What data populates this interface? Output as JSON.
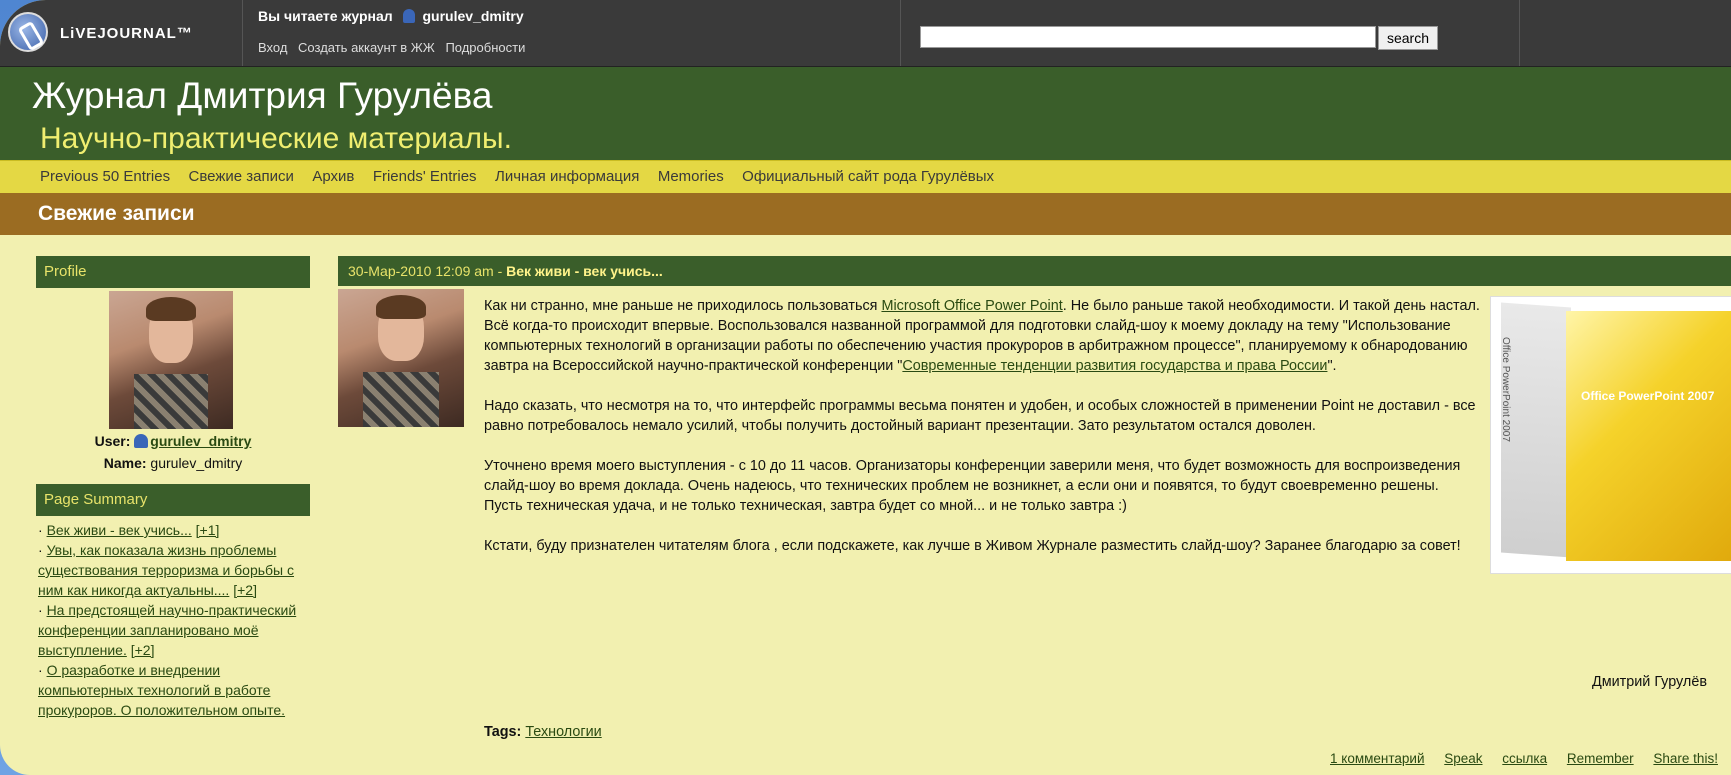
{
  "top": {
    "logo": "LiVEJOURNAL™",
    "reading_prefix": "Вы читаете журнал",
    "reading_user": "gurulev_dmitry",
    "links": [
      "Вход",
      "Создать аккаунт в ЖЖ",
      "Подробности"
    ],
    "search_placeholder": "",
    "search_button": "search"
  },
  "header": {
    "title": "Журнал Дмитрия Гурулёва",
    "subtitle": "Научно-практические материалы."
  },
  "nav": [
    "Previous 50 Entries",
    "Свежие записи",
    "Архив",
    "Friends' Entries",
    "Личная информация",
    "Memories",
    "Официальный сайт рода Гурулёвых"
  ],
  "section_title": "Свежие записи",
  "sidebar": {
    "profile_title": "Profile",
    "user_label": "User:",
    "user_name": "gurulev_dmitry",
    "name_label": "Name:",
    "name_value": "gurulev_dmitry",
    "summary_title": "Page Summary",
    "summary_items": [
      {
        "text": "Век живи - век учись...",
        "count": "[+1]"
      },
      {
        "text": "Увы, как показала жизнь проблемы существования терроризма и борьбы с ним как никогда актуальны....",
        "count": "[+2]"
      },
      {
        "text": "На предстоящей научно-практический конференции запланировано моё выступление.",
        "count": "[+2]"
      },
      {
        "text": "О разработке и внедрении компьютерных технологий в работе прокуроров. О положительном опыте.",
        "count": ""
      }
    ]
  },
  "entry": {
    "date": "30-Мар-2010 12:09 am -",
    "title": "Век живи - век учись...",
    "p1_a": "Как ни странно, мне раньше не приходилось пользоваться",
    "p1_link": "Microsoft Office Power Point",
    "p1_b": ". Не было раньше такой необходимости. И такой день настал. Всё когда-то происходит впервые. Воспользовался названной программой для подготовки слайд-шоу к моему докладу на тему \"Использование компьютерных технологий в организации работы по обеспечению участия прокуроров в арбитражном процессе\", планируемому к обнародованию завтра на Всероссийской научно-практической конференции \"",
    "p1_link2": "Современные тенденции развития государства и права России",
    "p1_c": "\".",
    "p2": "Надо сказать, что несмотря на то, что интерфейс программы весьма понятен и удобен, и особых сложностей в применении Point не доставил - все равно потребовалось немало усилий, чтобы получить достойный вариант презентации. Зато результатом остался доволен.",
    "p3": "Уточнено время моего выступления - с 10 до 11 часов. Организаторы конференции заверили меня, что будет возможность для воспроизведения слайд-шоу во время доклада. Очень надеюсь, что технических проблем не возникнет, а если они и появятся, то будут своевременно решены. Пусть техническая удача, и не только техническая, завтра будет со мной... и не только завтра :)",
    "p4": "Кстати, буду признателен читателям блога , если подскажете, как лучше в Живом Журнале разместить слайд-шоу? Заранее благодарю за совет!",
    "signature": "Дмитрий Гурулёв",
    "tags_label": "Tags:",
    "tag": "Технологии",
    "links": [
      "1 комментарий",
      "Speak",
      "ссылка",
      "Remember",
      "Share this!"
    ],
    "product_front": "Office PowerPoint 2007",
    "product_side": "Office PowerPoint 2007"
  }
}
